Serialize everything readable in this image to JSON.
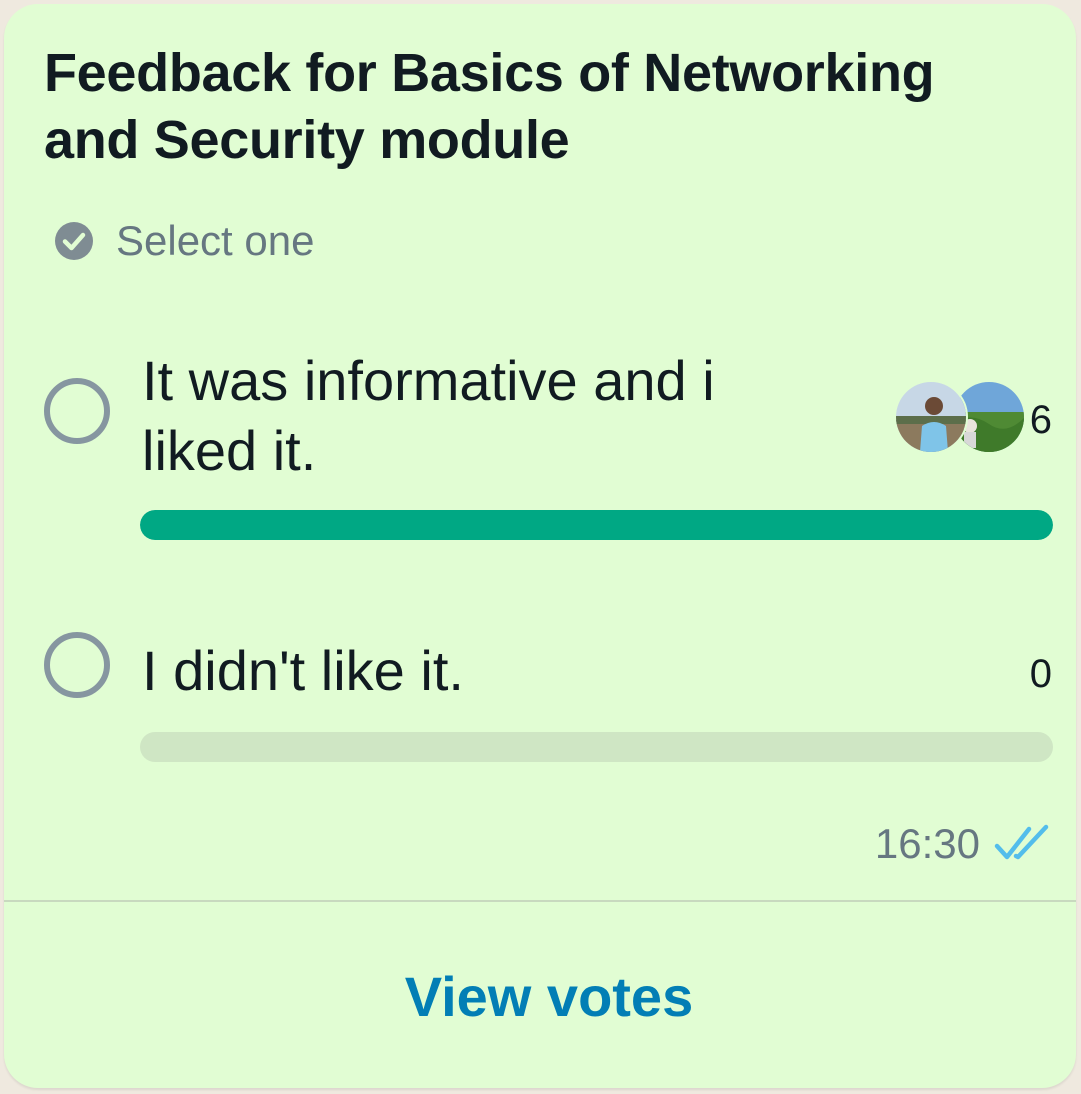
{
  "poll": {
    "title": "Feedback for Basics of Networking and Security module",
    "hint": "Select one",
    "options": [
      {
        "label": "It was informative and i liked it.",
        "votes": "6",
        "fill_fraction": 1.0
      },
      {
        "label": "I didn't like it.",
        "votes": "0",
        "fill_fraction": 0.0
      }
    ],
    "time": "16:30",
    "view_votes_label": "View votes"
  },
  "icons": {
    "hint": "check-circle-icon",
    "option_marker": "radio-circle-icon",
    "status": "double-check-read-icon"
  },
  "colors": {
    "bubble_bg": "#e1fdd3",
    "bar_fill": "#00a884",
    "bar_track": "#cfe6c4",
    "link": "#027eb5",
    "read_ticks": "#53bdeb"
  }
}
